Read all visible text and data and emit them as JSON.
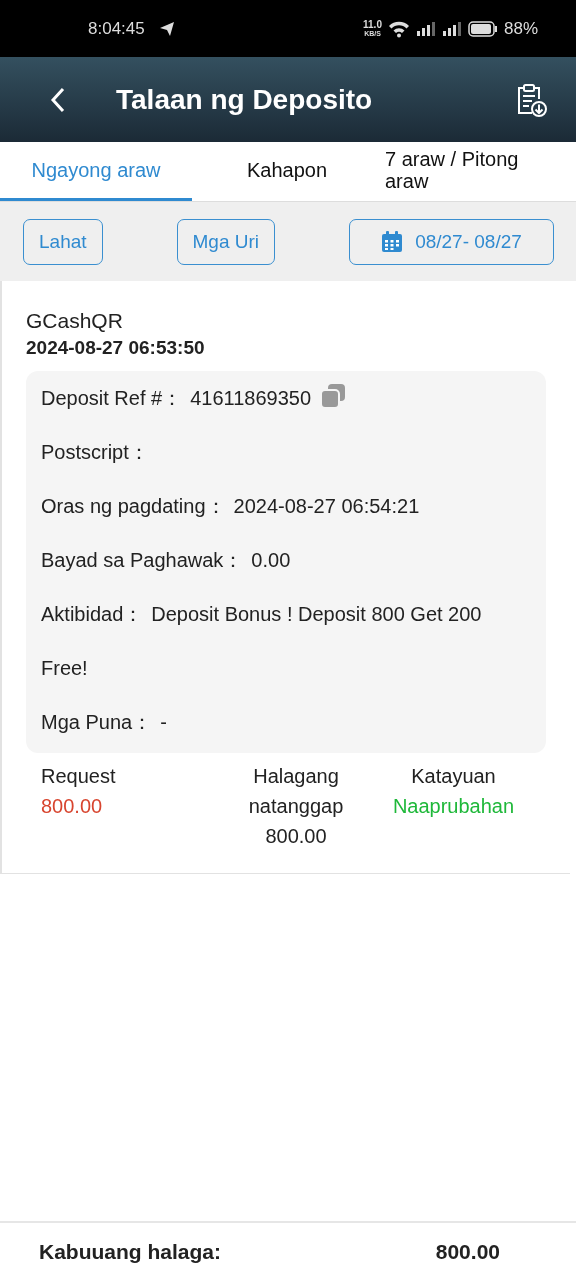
{
  "status_bar": {
    "time": "8:04:45",
    "net_speed": "11.0",
    "net_unit": "KB/S",
    "battery": "88%"
  },
  "header": {
    "title": "Talaan ng Deposito"
  },
  "tabs": [
    {
      "label": "Ngayong araw",
      "selected": true
    },
    {
      "label": "Kahapon",
      "selected": false
    },
    {
      "label": "7 araw / Pitong araw",
      "selected": false
    }
  ],
  "filters": [
    {
      "label": "Lahat",
      "kind": "plain"
    },
    {
      "label": "Mga Uri",
      "kind": "plain"
    },
    {
      "label": "08/27- 08/27",
      "kind": "date"
    }
  ],
  "record": {
    "method": "GCashQR",
    "datetime": "2024-08-27 06:53:50",
    "details": [
      {
        "label": "Deposit Ref #：",
        "value": "41611869350",
        "copyable": true
      },
      {
        "label": "Postscript：",
        "copyable": false
      },
      {
        "label": "Oras ng pagdating：",
        "value": "2024-08-27 06:54:21",
        "copyable": false
      },
      {
        "label": "Bayad sa Paghawak：",
        "value": "0.00",
        "copyable": false
      },
      {
        "label": "Aktibidad：",
        "value": "Deposit Bonus ! Deposit 800 Get 200 Free!",
        "copyable": false
      },
      {
        "label": "Mga Puna：",
        "value": "-",
        "copyable": false
      }
    ],
    "summary": [
      {
        "label": "Request",
        "value": "800.00",
        "color": "#d8452f"
      },
      {
        "label": "Halagang natanggap",
        "value": "800.00",
        "color": "#222222"
      },
      {
        "label": "Katayuan",
        "value": "Naaprubahan",
        "color": "#1fb83a"
      }
    ]
  },
  "footer": {
    "label": "Kabuuang halaga:",
    "value": "800.00"
  }
}
